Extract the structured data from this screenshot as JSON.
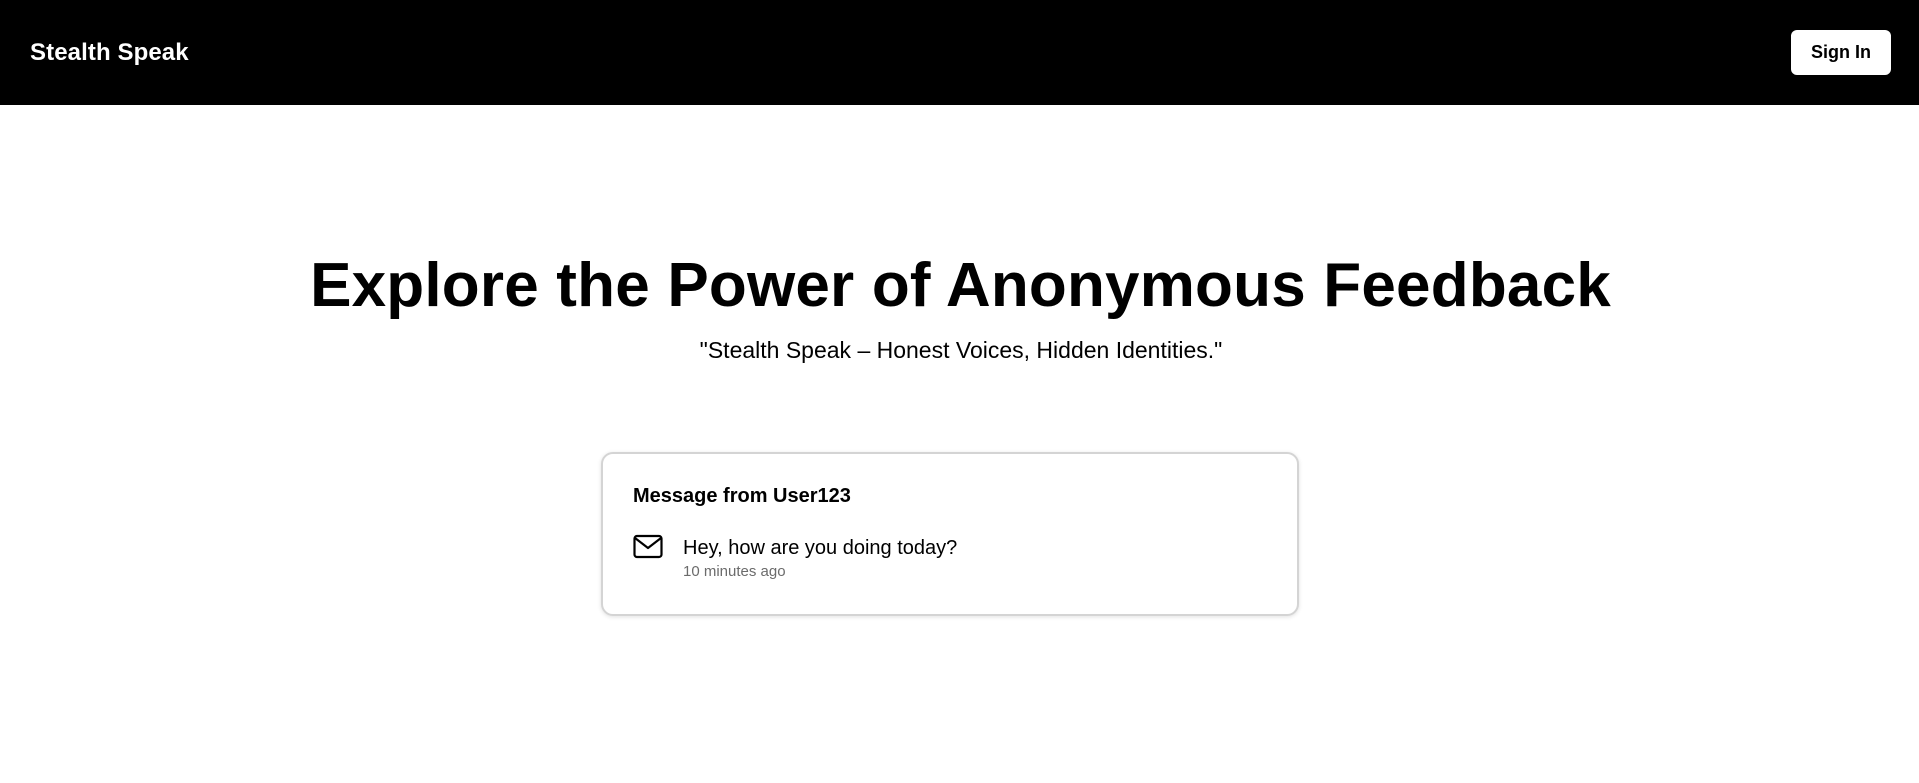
{
  "navbar": {
    "brand": "Stealth Speak",
    "sign_in_label": "Sign In"
  },
  "hero": {
    "title": "Explore the Power of Anonymous Feedback",
    "subtitle": "\"Stealth Speak – Honest Voices, Hidden Identities.\""
  },
  "message_card": {
    "title": "Message from User123",
    "icon": "mail-icon",
    "text": "Hey, how are you doing today?",
    "time": "10 minutes ago"
  },
  "colors": {
    "navbar_bg": "#000000",
    "brand_text": "#ffffff",
    "button_bg": "#ffffff",
    "muted_text": "#6b6b6b",
    "card_border": "#d4d4d4"
  }
}
